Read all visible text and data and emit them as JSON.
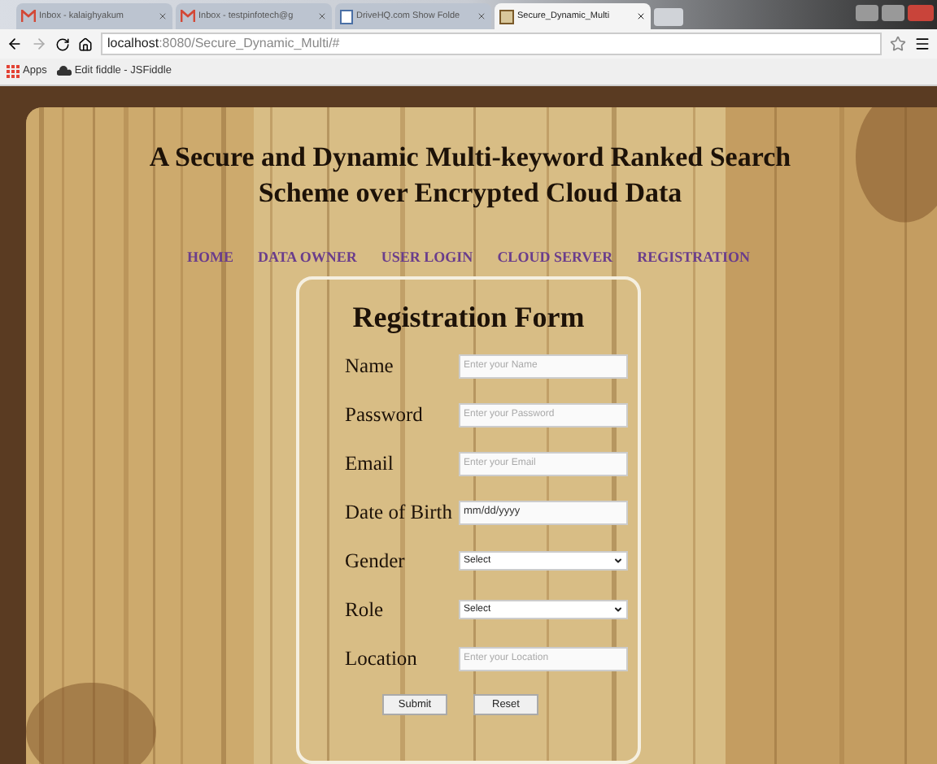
{
  "browser": {
    "tabs": [
      {
        "title": "Inbox - kalaighyakum",
        "selected": false
      },
      {
        "title": "Inbox - testpinfotech@g",
        "selected": false
      },
      {
        "title": "DriveHQ.com Show Folde",
        "selected": false
      },
      {
        "title": "Secure_Dynamic_Multi",
        "selected": true
      }
    ],
    "address": {
      "host": "localhost",
      "rest": ":8080/Secure_Dynamic_Multi/#"
    },
    "bookmarks": [
      {
        "label": "Apps"
      },
      {
        "label": "Edit fiddle - JSFiddle"
      }
    ]
  },
  "page": {
    "title_lines": [
      "A Secure and Dynamic Multi-keyword Ranked Search",
      "Scheme over Encrypted Cloud Data"
    ],
    "nav": [
      "HOME",
      "DATA OWNER",
      "USER LOGIN",
      "CLOUD SERVER",
      "REGISTRATION"
    ],
    "form": {
      "title": "Registration Form",
      "fields": [
        {
          "label": "Name",
          "kind": "text",
          "placeholder": "Enter your Name"
        },
        {
          "label": "Password",
          "kind": "text",
          "placeholder": "Enter your Password"
        },
        {
          "label": "Email",
          "kind": "text",
          "placeholder": "Enter your Email"
        },
        {
          "label": "Date of Birth",
          "kind": "date",
          "value": "mm/dd/yyyy"
        },
        {
          "label": "Gender",
          "kind": "select",
          "value": "Select"
        },
        {
          "label": "Role",
          "kind": "select",
          "value": "Select"
        },
        {
          "label": "Location",
          "kind": "text",
          "placeholder": "Enter your Location"
        }
      ],
      "buttons": [
        "Submit",
        "Reset"
      ]
    }
  }
}
